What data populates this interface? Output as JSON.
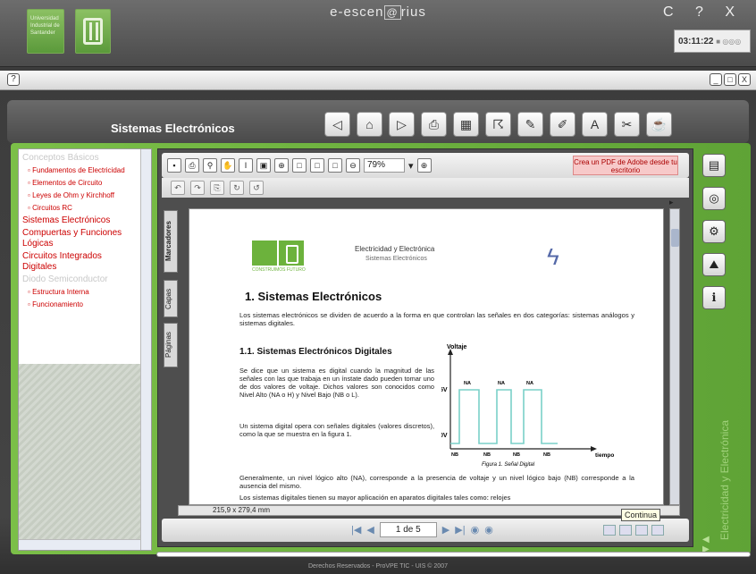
{
  "topbar": {
    "logo_text": "Universidad Industrial de Santander",
    "brand": "e-escen",
    "brand_mid": "@",
    "brand_tail": "rius",
    "window_controls": "C ? X",
    "clock": "03:11:22",
    "clock_suffix": "■ ◎◎◎"
  },
  "bar2": {
    "help": "?",
    "controls": [
      "_",
      "□",
      "X"
    ]
  },
  "band": {
    "title": "Sistemas Electrónicos",
    "nav_icons": [
      "◁",
      "⌂",
      "▷",
      "⎙",
      "▦",
      "☈",
      "✎",
      "✐",
      "A",
      "✂",
      "☕"
    ]
  },
  "sidebar": {
    "items": [
      {
        "type": "sec",
        "label": "Conceptos Básicos"
      },
      {
        "type": "sub",
        "label": "Fundamentos de Electricidad"
      },
      {
        "type": "sub",
        "label": "Elementos de Circuito"
      },
      {
        "type": "sub",
        "label": "Leyes de Ohm y Kirchhoff"
      },
      {
        "type": "sub",
        "label": "Circuitos RC"
      },
      {
        "type": "main",
        "label": "Sistemas Electrónicos"
      },
      {
        "type": "main",
        "label": "Compuertas y Funciones Lógicas"
      },
      {
        "type": "main",
        "label": "Circuitos Integrados Digitales"
      },
      {
        "type": "sec",
        "label": "Diodo Semiconductor"
      },
      {
        "type": "sub",
        "label": "Estructura Interna"
      },
      {
        "type": "sub",
        "label": "Funcionamiento"
      }
    ]
  },
  "viewer": {
    "zoom": "79%",
    "pdf_button": "Crea un PDF de Adobe desde tu escritorio",
    "tabs": [
      "Marcadores",
      "Capas",
      "Páginas"
    ],
    "page_size": "215,9 x 279,4 mm",
    "page_indicator": "1 de 5",
    "tooltip": "Continua"
  },
  "doc": {
    "header_title": "Electricidad y Electrónica",
    "header_sub": "Sistemas Electrónicos",
    "logo_caption": "CONSTRUIMOS FUTURO",
    "h1": "1.   Sistemas Electrónicos",
    "p1": "Los sistemas electrónicos se dividen de acuerdo a la forma en que controlan las señales en dos categorías: sistemas análogos y sistemas digitales.",
    "h2": "1.1.   Sistemas Electrónicos Digitales",
    "p2": "Se dice que un sistema es digital cuando la magnitud de las señales con las que trabaja en un ínstate dado pueden tomar uno de dos valores de voltaje. Dichos valores son conocidos como Nivel Alto (NA o H) y Nivel Bajo (NB o L).",
    "p3": "Un sistema digital opera con señales digitales (valores discretos), como la que se muestra en la figura 1.",
    "p4": "Generalmente, un nivel lógico alto (NA), corresponde a la presencia de voltaje y un nivel lógico bajo (NB) corresponde a la ausencia del mismo.",
    "p5": "Los sistemas digitales tienen su mayor aplicación en aparatos digitales tales como: relojes",
    "chart": {
      "ylabel": "Voltaje",
      "xlabel": "tiempo",
      "y_high": "5V",
      "y_low": "0V",
      "high_label": "NA",
      "low_label": "NB",
      "caption": "Figura 1. Señal Digital"
    }
  },
  "rail": {
    "icons": [
      "▤",
      "◎",
      "⚙",
      "⛰",
      "ℹ"
    ],
    "text": "Electricidad y Electrónica"
  },
  "footer": "Derechos Reservados - ProVPE TIC - UIS © 2007"
}
